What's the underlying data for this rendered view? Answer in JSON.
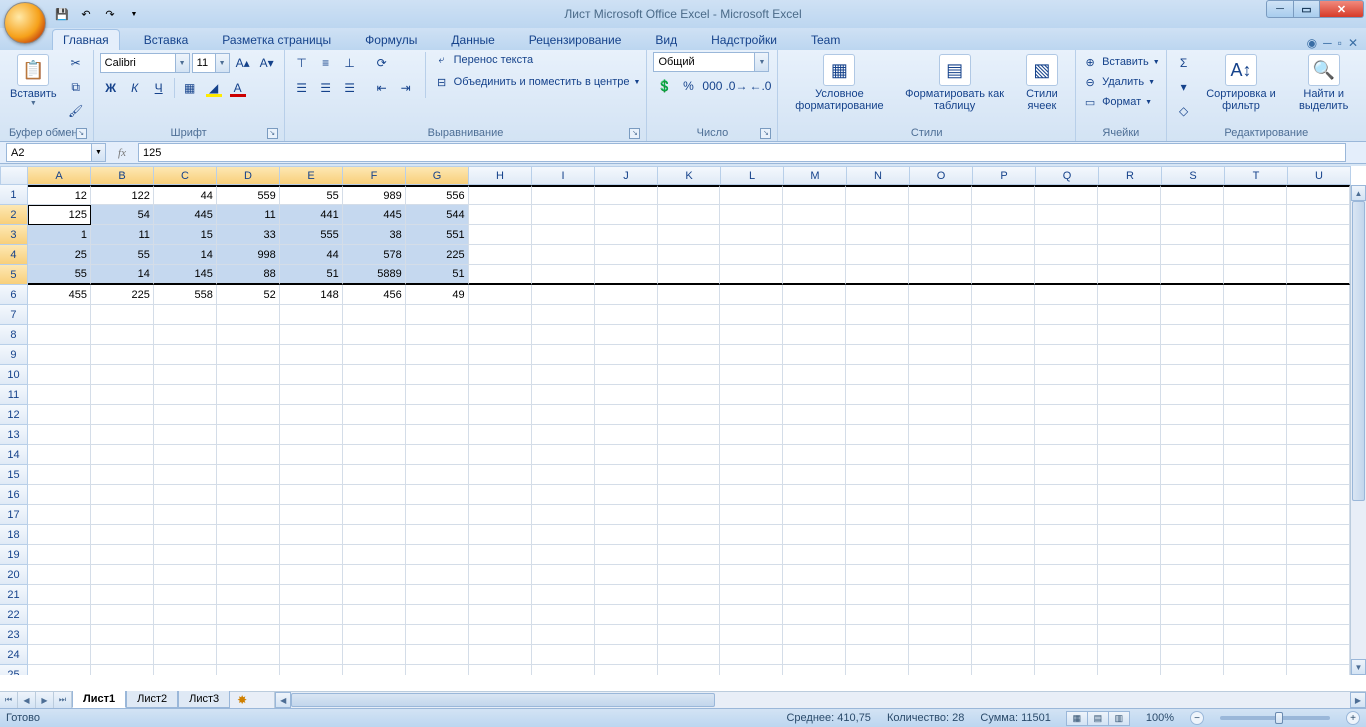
{
  "title": "Лист Microsoft Office Excel - Microsoft Excel",
  "tabs": {
    "home": "Главная",
    "insert": "Вставка",
    "layout": "Разметка страницы",
    "formulas": "Формулы",
    "data": "Данные",
    "review": "Рецензирование",
    "view": "Вид",
    "addins": "Надстройки",
    "team": "Team"
  },
  "ribbon": {
    "clipboard": {
      "paste": "Вставить",
      "label": "Буфер обмена"
    },
    "font": {
      "family": "Calibri",
      "size": "11",
      "bold": "Ж",
      "italic": "К",
      "underline": "Ч",
      "label": "Шрифт"
    },
    "align": {
      "wrap": "Перенос текста",
      "merge": "Объединить и поместить в центре",
      "label": "Выравнивание"
    },
    "number": {
      "format": "Общий",
      "label": "Число"
    },
    "styles": {
      "cond": "Условное форматирование",
      "table": "Форматировать как таблицу",
      "cell": "Стили ячеек",
      "label": "Стили"
    },
    "cells": {
      "insert": "Вставить",
      "delete": "Удалить",
      "format": "Формат",
      "label": "Ячейки"
    },
    "editing": {
      "sort": "Сортировка и фильтр",
      "find": "Найти и выделить",
      "label": "Редактирование"
    }
  },
  "namebox": "A2",
  "formula": "125",
  "columns": [
    "A",
    "B",
    "C",
    "D",
    "E",
    "F",
    "G",
    "H",
    "I",
    "J",
    "K",
    "L",
    "M",
    "N",
    "O",
    "P",
    "Q",
    "R",
    "S",
    "T",
    "U"
  ],
  "selected_cols": [
    "A",
    "B",
    "C",
    "D",
    "E",
    "F",
    "G"
  ],
  "grid": [
    [
      "12",
      "122",
      "44",
      "559",
      "55",
      "989",
      "556"
    ],
    [
      "125",
      "54",
      "445",
      "11",
      "441",
      "445",
      "544"
    ],
    [
      "1",
      "11",
      "15",
      "33",
      "555",
      "38",
      "551"
    ],
    [
      "25",
      "55",
      "14",
      "998",
      "44",
      "578",
      "225"
    ],
    [
      "55",
      "14",
      "145",
      "88",
      "51",
      "5889",
      "51"
    ],
    [
      "455",
      "225",
      "558",
      "52",
      "148",
      "456",
      "49"
    ]
  ],
  "total_rows": 25,
  "active_cell": {
    "row": 2,
    "col": 0
  },
  "selection": {
    "row_start": 2,
    "row_end": 5
  },
  "border_rows": {
    "top_above": 1,
    "bottom_of": 5
  },
  "sheets": {
    "s1": "Лист1",
    "s2": "Лист2",
    "s3": "Лист3"
  },
  "status": {
    "ready": "Готово",
    "avg_label": "Среднее:",
    "avg": "410,75",
    "count_label": "Количество:",
    "count": "28",
    "sum_label": "Сумма:",
    "sum": "11501",
    "zoom": "100%"
  }
}
